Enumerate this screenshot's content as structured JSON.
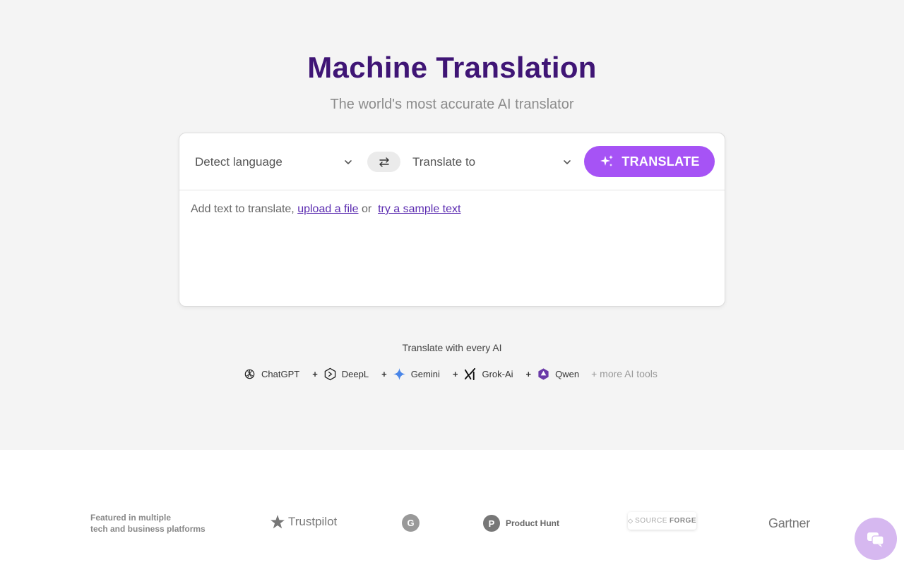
{
  "hero": {
    "title": "Machine Translation",
    "subtitle": "The world's most accurate AI translator"
  },
  "translator": {
    "source_language": "Detect language",
    "target_language": "Translate to",
    "translate_label": "TRANSLATE",
    "input_prompt": "Add text to translate,",
    "upload_link": "upload a file",
    "or_text": "or",
    "sample_link": "try a sample text"
  },
  "ai_tools": {
    "heading": "Translate with every AI",
    "items": [
      {
        "label": "ChatGPT",
        "icon": "chatgpt-icon"
      },
      {
        "label": "DeepL",
        "icon": "deepl-icon"
      },
      {
        "label": "Gemini",
        "icon": "gemini-icon"
      },
      {
        "label": "Grok-Ai",
        "icon": "grok-icon"
      },
      {
        "label": "Qwen",
        "icon": "qwen-icon"
      }
    ],
    "plus": "+",
    "more": "+ more AI tools"
  },
  "featured": {
    "line1": "Featured in multiple",
    "line2": "tech and business platforms",
    "logos": {
      "trustpilot": "Trustpilot",
      "g2": "G",
      "producthunt": "Product Hunt",
      "producthunt_mark": "P",
      "sourceforge_a": "SOURCE",
      "sourceforge_b": "FORGE",
      "gartner": "Gartner"
    }
  },
  "colors": {
    "title": "#3f1575",
    "accent": "#a653f5",
    "link": "#5b2bb0",
    "hero_bg": "#f4f4f4"
  }
}
